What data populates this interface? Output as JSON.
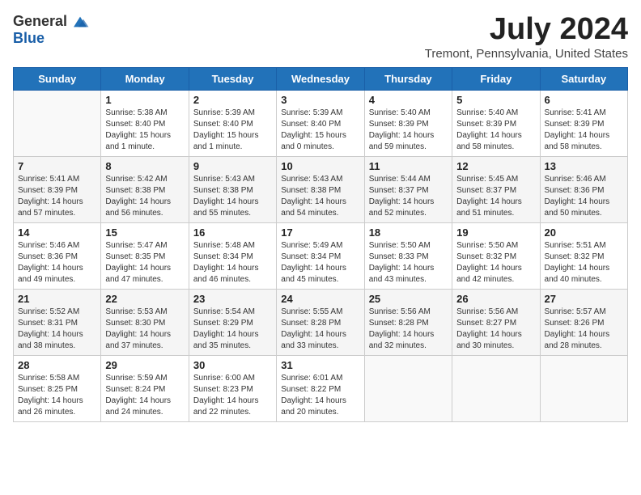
{
  "header": {
    "logo_general": "General",
    "logo_blue": "Blue",
    "month_title": "July 2024",
    "subtitle": "Tremont, Pennsylvania, United States"
  },
  "days_of_week": [
    "Sunday",
    "Monday",
    "Tuesday",
    "Wednesday",
    "Thursday",
    "Friday",
    "Saturday"
  ],
  "weeks": [
    [
      {
        "day": "",
        "info": ""
      },
      {
        "day": "1",
        "info": "Sunrise: 5:38 AM\nSunset: 8:40 PM\nDaylight: 15 hours\nand 1 minute."
      },
      {
        "day": "2",
        "info": "Sunrise: 5:39 AM\nSunset: 8:40 PM\nDaylight: 15 hours\nand 1 minute."
      },
      {
        "day": "3",
        "info": "Sunrise: 5:39 AM\nSunset: 8:40 PM\nDaylight: 15 hours\nand 0 minutes."
      },
      {
        "day": "4",
        "info": "Sunrise: 5:40 AM\nSunset: 8:39 PM\nDaylight: 14 hours\nand 59 minutes."
      },
      {
        "day": "5",
        "info": "Sunrise: 5:40 AM\nSunset: 8:39 PM\nDaylight: 14 hours\nand 58 minutes."
      },
      {
        "day": "6",
        "info": "Sunrise: 5:41 AM\nSunset: 8:39 PM\nDaylight: 14 hours\nand 58 minutes."
      }
    ],
    [
      {
        "day": "7",
        "info": "Sunrise: 5:41 AM\nSunset: 8:39 PM\nDaylight: 14 hours\nand 57 minutes."
      },
      {
        "day": "8",
        "info": "Sunrise: 5:42 AM\nSunset: 8:38 PM\nDaylight: 14 hours\nand 56 minutes."
      },
      {
        "day": "9",
        "info": "Sunrise: 5:43 AM\nSunset: 8:38 PM\nDaylight: 14 hours\nand 55 minutes."
      },
      {
        "day": "10",
        "info": "Sunrise: 5:43 AM\nSunset: 8:38 PM\nDaylight: 14 hours\nand 54 minutes."
      },
      {
        "day": "11",
        "info": "Sunrise: 5:44 AM\nSunset: 8:37 PM\nDaylight: 14 hours\nand 52 minutes."
      },
      {
        "day": "12",
        "info": "Sunrise: 5:45 AM\nSunset: 8:37 PM\nDaylight: 14 hours\nand 51 minutes."
      },
      {
        "day": "13",
        "info": "Sunrise: 5:46 AM\nSunset: 8:36 PM\nDaylight: 14 hours\nand 50 minutes."
      }
    ],
    [
      {
        "day": "14",
        "info": "Sunrise: 5:46 AM\nSunset: 8:36 PM\nDaylight: 14 hours\nand 49 minutes."
      },
      {
        "day": "15",
        "info": "Sunrise: 5:47 AM\nSunset: 8:35 PM\nDaylight: 14 hours\nand 47 minutes."
      },
      {
        "day": "16",
        "info": "Sunrise: 5:48 AM\nSunset: 8:34 PM\nDaylight: 14 hours\nand 46 minutes."
      },
      {
        "day": "17",
        "info": "Sunrise: 5:49 AM\nSunset: 8:34 PM\nDaylight: 14 hours\nand 45 minutes."
      },
      {
        "day": "18",
        "info": "Sunrise: 5:50 AM\nSunset: 8:33 PM\nDaylight: 14 hours\nand 43 minutes."
      },
      {
        "day": "19",
        "info": "Sunrise: 5:50 AM\nSunset: 8:32 PM\nDaylight: 14 hours\nand 42 minutes."
      },
      {
        "day": "20",
        "info": "Sunrise: 5:51 AM\nSunset: 8:32 PM\nDaylight: 14 hours\nand 40 minutes."
      }
    ],
    [
      {
        "day": "21",
        "info": "Sunrise: 5:52 AM\nSunset: 8:31 PM\nDaylight: 14 hours\nand 38 minutes."
      },
      {
        "day": "22",
        "info": "Sunrise: 5:53 AM\nSunset: 8:30 PM\nDaylight: 14 hours\nand 37 minutes."
      },
      {
        "day": "23",
        "info": "Sunrise: 5:54 AM\nSunset: 8:29 PM\nDaylight: 14 hours\nand 35 minutes."
      },
      {
        "day": "24",
        "info": "Sunrise: 5:55 AM\nSunset: 8:28 PM\nDaylight: 14 hours\nand 33 minutes."
      },
      {
        "day": "25",
        "info": "Sunrise: 5:56 AM\nSunset: 8:28 PM\nDaylight: 14 hours\nand 32 minutes."
      },
      {
        "day": "26",
        "info": "Sunrise: 5:56 AM\nSunset: 8:27 PM\nDaylight: 14 hours\nand 30 minutes."
      },
      {
        "day": "27",
        "info": "Sunrise: 5:57 AM\nSunset: 8:26 PM\nDaylight: 14 hours\nand 28 minutes."
      }
    ],
    [
      {
        "day": "28",
        "info": "Sunrise: 5:58 AM\nSunset: 8:25 PM\nDaylight: 14 hours\nand 26 minutes."
      },
      {
        "day": "29",
        "info": "Sunrise: 5:59 AM\nSunset: 8:24 PM\nDaylight: 14 hours\nand 24 minutes."
      },
      {
        "day": "30",
        "info": "Sunrise: 6:00 AM\nSunset: 8:23 PM\nDaylight: 14 hours\nand 22 minutes."
      },
      {
        "day": "31",
        "info": "Sunrise: 6:01 AM\nSunset: 8:22 PM\nDaylight: 14 hours\nand 20 minutes."
      },
      {
        "day": "",
        "info": ""
      },
      {
        "day": "",
        "info": ""
      },
      {
        "day": "",
        "info": ""
      }
    ]
  ]
}
